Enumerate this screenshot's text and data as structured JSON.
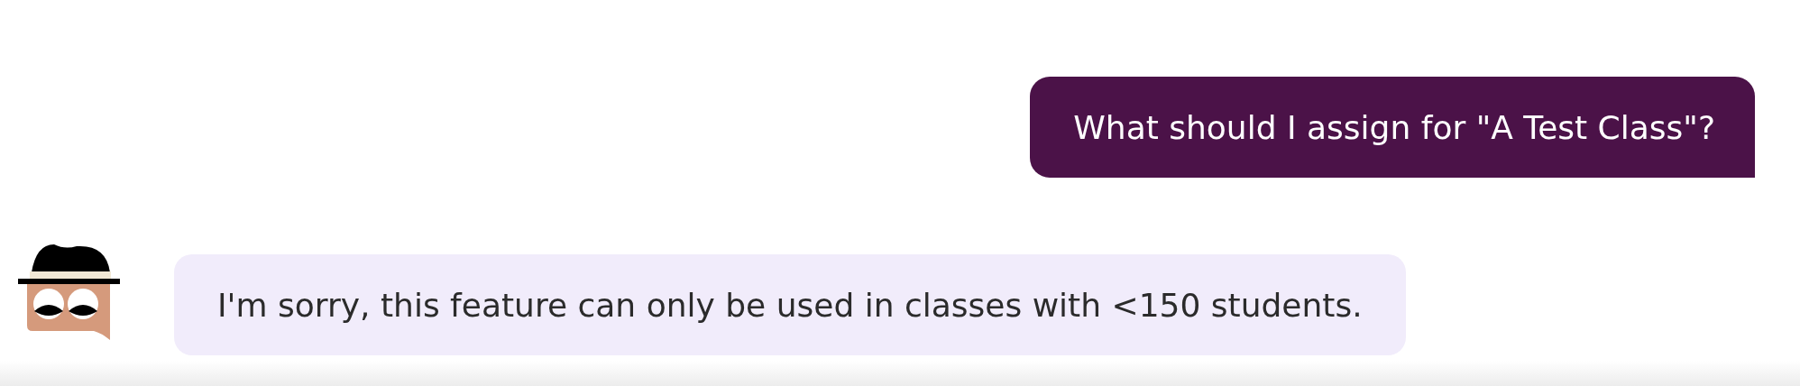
{
  "messages": [
    {
      "kind": "outgoing",
      "text": "What should I assign for \"A Test Class\"?"
    },
    {
      "kind": "incoming",
      "text": "I'm sorry, this feature can only be used in classes with <150 students."
    }
  ]
}
